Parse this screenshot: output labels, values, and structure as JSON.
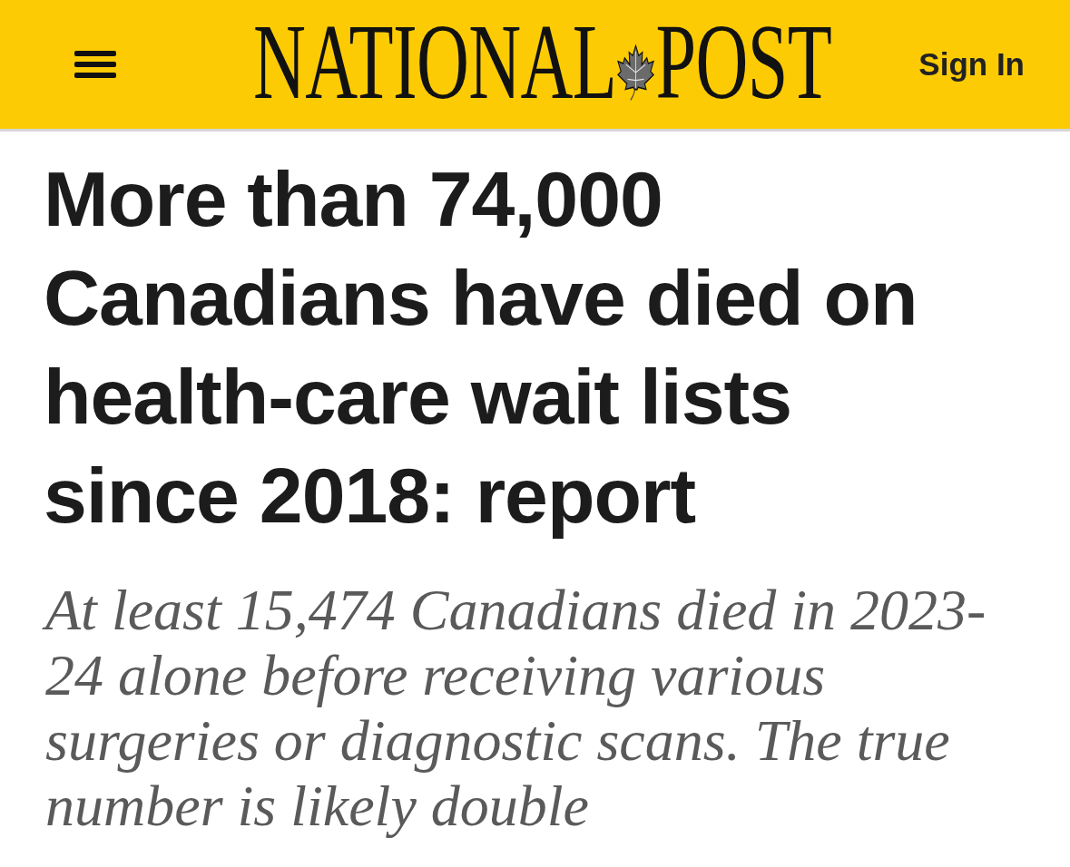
{
  "header": {
    "logo": {
      "left": "NATIONAL",
      "right": "POST"
    },
    "sign_in": "Sign In"
  },
  "article": {
    "headline": "More than 74,000 Canadians have died on health-care wait lists since 2018: report",
    "subheadline": "At least 15,474 Canadians died in 2023-24 alone before receiving various surgeries or diagnostic scans. The true number is likely double"
  }
}
